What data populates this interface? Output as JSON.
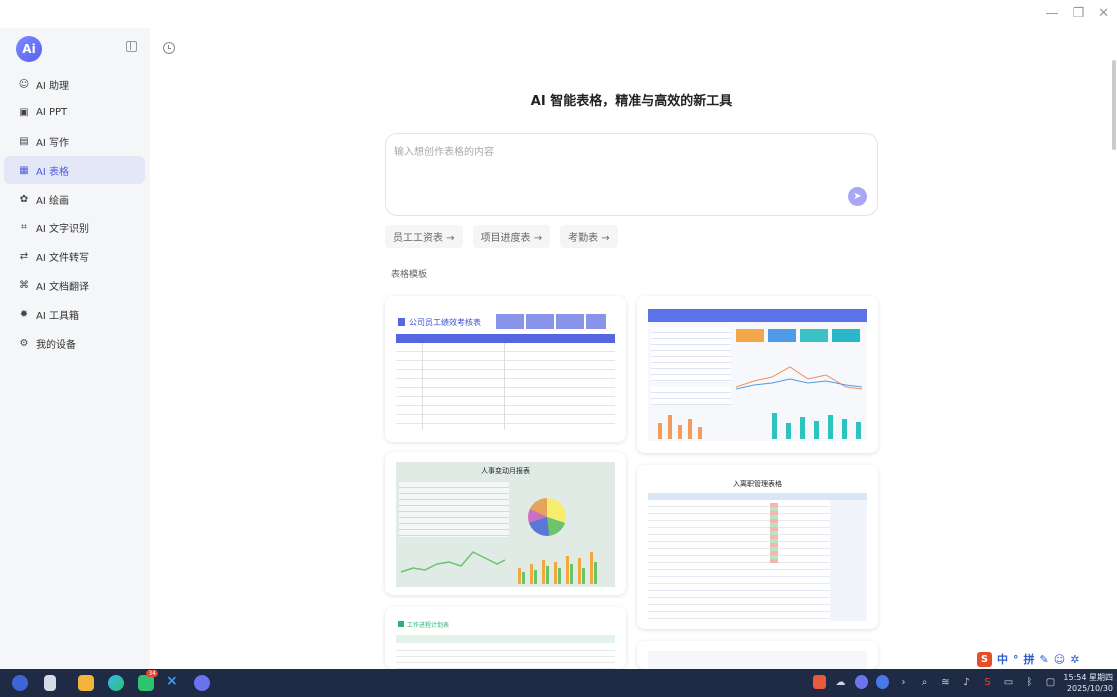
{
  "sidebar": {
    "logo": "Ai",
    "items": [
      {
        "label": "AI 助理",
        "icon": "assistant-icon"
      },
      {
        "label": "AI PPT",
        "icon": "ppt-icon"
      },
      {
        "label": "AI 写作",
        "icon": "writing-icon"
      },
      {
        "label": "AI 表格",
        "icon": "table-icon",
        "active": true
      },
      {
        "label": "AI 绘画",
        "icon": "paint-icon"
      },
      {
        "label": "AI 文字识别",
        "icon": "ocr-icon"
      },
      {
        "label": "AI 文件转写",
        "icon": "transcribe-icon"
      },
      {
        "label": "AI 文档翻译",
        "icon": "translate-icon"
      },
      {
        "label": "AI 工具箱",
        "icon": "toolbox-icon"
      },
      {
        "label": "我的设备",
        "icon": "device-icon"
      }
    ]
  },
  "main": {
    "title": "AI 智能表格，精准与高效的新工具",
    "prompt": {
      "placeholder": "输入想创作表格的内容",
      "value": ""
    },
    "chips": [
      {
        "label": "员工工资表 →"
      },
      {
        "label": "项目进度表 →"
      },
      {
        "label": "考勤表 →"
      }
    ],
    "section_title": "表格模板",
    "templates": [
      {
        "title": "公司员工绩效考核表"
      },
      {
        "title": ""
      },
      {
        "title": "人事变动月报表"
      },
      {
        "title": "入离职管理表格"
      },
      {
        "title": "工作进程计划表"
      },
      {
        "title": ""
      }
    ]
  },
  "ime": {
    "chars": [
      "中",
      "°",
      "拼"
    ]
  },
  "taskbar": {
    "time": "15:54 星期四",
    "date": "2025/10/30",
    "badge": "34"
  },
  "colors": {
    "accent": "#4e5bd9",
    "send": "#a7a7f5",
    "taskbar": "#1f2a44"
  }
}
